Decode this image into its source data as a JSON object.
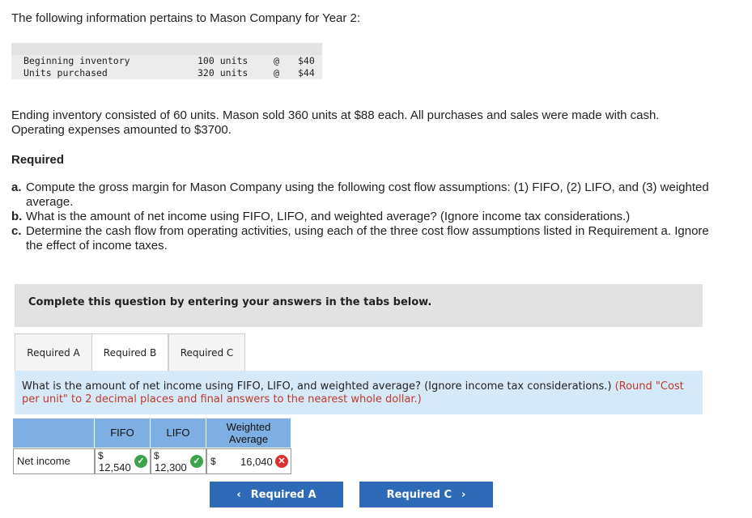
{
  "intro": "The following information pertains to Mason Company for Year 2:",
  "inventory_table": [
    {
      "label": "Beginning inventory",
      "units": "100 units",
      "at": "@",
      "cost": "$40"
    },
    {
      "label": "Units purchased",
      "units": "320 units",
      "at": "@",
      "cost": "$44"
    }
  ],
  "paragraph": "Ending inventory consisted of 60 units. Mason sold 360 units at $88 each. All purchases and sales were made with cash. Operating expenses amounted to $3700.",
  "required_heading": "Required",
  "requirements": [
    {
      "label": "a.",
      "text": "Compute the gross margin for Mason Company using the following cost flow assumptions: (1) FIFO, (2) LIFO, and (3) weighted average."
    },
    {
      "label": "b.",
      "text": "What is the amount of net income using FIFO, LIFO, and weighted average? (Ignore income tax considerations.)"
    },
    {
      "label": "c.",
      "text": "Determine the cash flow from operating activities, using each of the three cost flow assumptions listed in Requirement a. Ignore the effect of income taxes."
    }
  ],
  "banner": "Complete this question by entering your answers in the tabs below.",
  "tabs": [
    "Required A",
    "Required B",
    "Required C"
  ],
  "active_tab": "Required B",
  "question": {
    "main": "What is the amount of net income using FIFO, LIFO, and weighted average? (Ignore income tax considerations.)",
    "note": "(Round \"Cost per unit\" to 2 decimal places and final answers to the nearest whole dollar.)"
  },
  "answer_table": {
    "headers": [
      "FIFO",
      "LIFO",
      "Weighted Average"
    ],
    "row_label": "Net income",
    "currency": "$",
    "values": [
      "12,540",
      "12,300",
      "16,040"
    ],
    "status": [
      "correct",
      "correct",
      "incorrect"
    ]
  },
  "nav": {
    "prev": "Required A",
    "next": "Required C"
  },
  "colors": {
    "header_blue": "#7dafe3",
    "question_bg": "#d6e9f8",
    "button": "#2e6ab8",
    "correct": "#3ea34a",
    "incorrect": "#d93030"
  }
}
